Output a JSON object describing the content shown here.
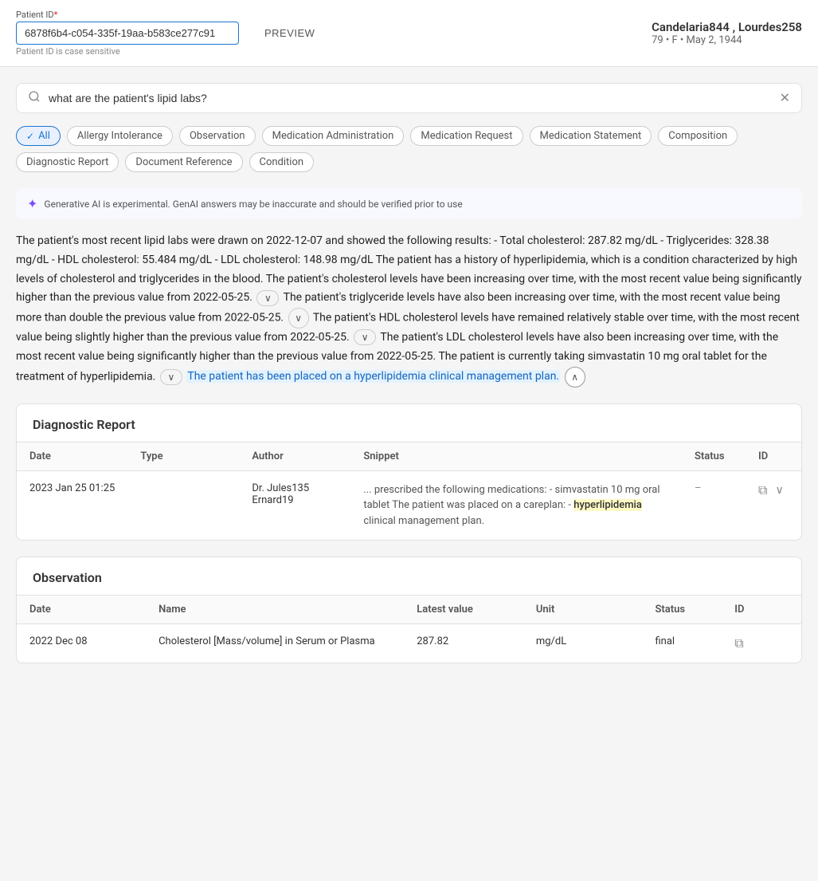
{
  "header": {
    "patient_id_label": "Patient ID",
    "patient_id_required": "*",
    "patient_id_value": "6878f6b4-c054-335f-19aa-b583ce277c91",
    "patient_id_hint": "Patient ID is case sensitive",
    "preview_label": "PREVIEW",
    "patient_name": "Candelaria844 , Lourdes258",
    "patient_details": "79 • F • May 2, 1944"
  },
  "search": {
    "placeholder": "what are the patient's lipid labs?",
    "value": "what are the patient's lipid labs?"
  },
  "filter_chips": [
    {
      "label": "All",
      "active": true
    },
    {
      "label": "Allergy Intolerance",
      "active": false
    },
    {
      "label": "Observation",
      "active": false
    },
    {
      "label": "Medication Administration",
      "active": false
    },
    {
      "label": "Medication Request",
      "active": false
    },
    {
      "label": "Medication Statement",
      "active": false
    },
    {
      "label": "Composition",
      "active": false
    },
    {
      "label": "Diagnostic Report",
      "active": false
    },
    {
      "label": "Document Reference",
      "active": false
    },
    {
      "label": "Condition",
      "active": false
    }
  ],
  "ai_notice": "Generative AI is experimental. GenAI answers may be inaccurate and should be verified prior to use",
  "answer": {
    "part1": "The patient's most recent lipid labs were drawn on 2022-12-07 and showed the following results: - Total cholesterol: 287.82 mg/dL - Triglycerides: 328.38 mg/dL - HDL cholesterol: 55.484 mg/dL - LDL cholesterol: 148.98 mg/dL The patient has a history of hyperlipidemia, which is a condition characterized by high levels of cholesterol and triglycerides in the blood. The patient's cholesterol levels have been increasing over time, with the most recent value being significantly higher than the previous value from 2022-05-25.",
    "part2": "The patient's triglyceride levels have also been increasing over time, with the most recent value being more than double the previous value from 2022-05-25.",
    "part3": "The patient's HDL cholesterol levels have remained relatively stable over time, with the most recent value being slightly higher than the previous value from 2022-05-25.",
    "part4": "The patient's LDL cholesterol levels have also been increasing over time, with the most recent value being significantly higher than the previous value from 2022-05-25. The patient is currently taking simvastatin 10 mg oral tablet for the treatment of hyperlipidemia.",
    "part5_highlighted": "The patient has been placed on a hyperlipidemia clinical management plan."
  },
  "diagnostic_report": {
    "title": "Diagnostic Report",
    "columns": [
      "Date",
      "Type",
      "Author",
      "Snippet",
      "Status",
      "ID"
    ],
    "rows": [
      {
        "date": "2023  Jan  25  01:25",
        "type": "",
        "author_line1": "Dr. Jules135",
        "author_line2": "Ernard19",
        "snippet_prefix": "... prescribed the following medications: - simvastatin 10 mg oral tablet The patient was placed on a careplan: -",
        "snippet_highlight": "hyperlipidemia",
        "snippet_suffix": "clinical management plan.",
        "status": "–",
        "id": ""
      }
    ]
  },
  "observation": {
    "title": "Observation",
    "columns": [
      "Date",
      "Name",
      "Latest value",
      "Unit",
      "Status",
      "ID"
    ],
    "rows": [
      {
        "date": "2022  Dec  08",
        "name": "Cholesterol [Mass/volume] in Serum or Plasma",
        "latest_value": "287.82",
        "unit": "mg/dL",
        "status": "final",
        "id": ""
      }
    ]
  }
}
